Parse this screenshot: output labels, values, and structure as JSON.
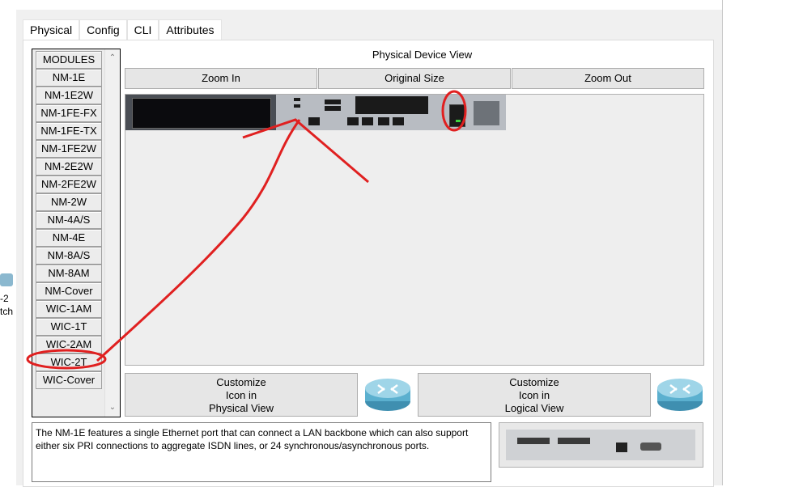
{
  "tabs": [
    "Physical",
    "Config",
    "CLI",
    "Attributes"
  ],
  "modules": {
    "header": "MODULES",
    "items": [
      "NM-1E",
      "NM-1E2W",
      "NM-1FE-FX",
      "NM-1FE-TX",
      "NM-1FE2W",
      "NM-2E2W",
      "NM-2FE2W",
      "NM-2W",
      "NM-4A/S",
      "NM-4E",
      "NM-8A/S",
      "NM-8AM",
      "NM-Cover",
      "WIC-1AM",
      "WIC-1T",
      "WIC-2AM",
      "WIC-2T",
      "WIC-Cover"
    ]
  },
  "device_view": {
    "title": "Physical Device View",
    "zoom_in": "Zoom In",
    "original_size": "Original Size",
    "zoom_out": "Zoom Out"
  },
  "customize": {
    "physical": [
      "Customize",
      "Icon in",
      "Physical View"
    ],
    "logical": [
      "Customize",
      "Icon in",
      "Logical View"
    ]
  },
  "description": "The NM-1E features a single Ethernet port that can connect a LAN backbone which can also support either six PRI connections to aggregate ISDN lines, or 24 synchronous/asynchronous ports.",
  "left_strip": {
    "line1": "-2",
    "line2": "tch"
  },
  "colors": {
    "accent": "#1f5fb0",
    "annotation": "#e02020",
    "led": "#3fd43f"
  }
}
